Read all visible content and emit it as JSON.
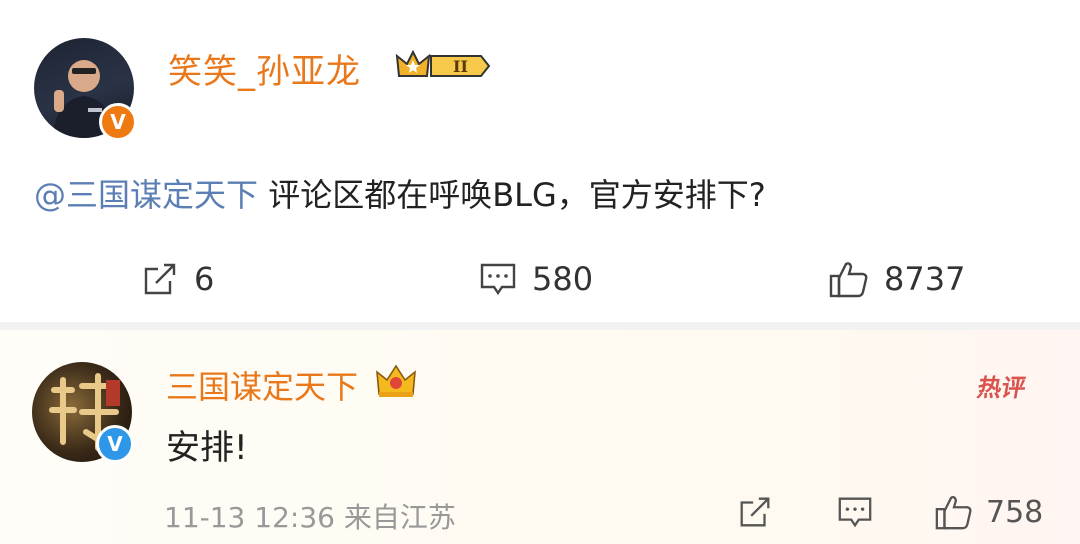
{
  "post": {
    "author": "笑笑_孙亚龙",
    "level_badge": "II",
    "mention": "@三国谋定天下",
    "text": " 评论区都在呼唤BLG，官方安排下?",
    "repost_count": "6",
    "comment_count": "580",
    "like_count": "8737"
  },
  "comment": {
    "author": "三国谋定天下",
    "hot_label": "热评",
    "text": "安排!",
    "time": "11-13 12:36",
    "location": "来自江苏",
    "like_count": "758"
  },
  "colors": {
    "name_orange": "#e8781a",
    "mention_blue": "#5b7fb4",
    "verified_orange": "#f07a12",
    "verified_blue": "#2f97e8",
    "hot_red": "#d9534f"
  },
  "icons": {
    "repost": "share-arrow-icon",
    "comment": "comment-bubble-icon",
    "like": "thumbs-up-icon",
    "crown": "crown-icon"
  }
}
